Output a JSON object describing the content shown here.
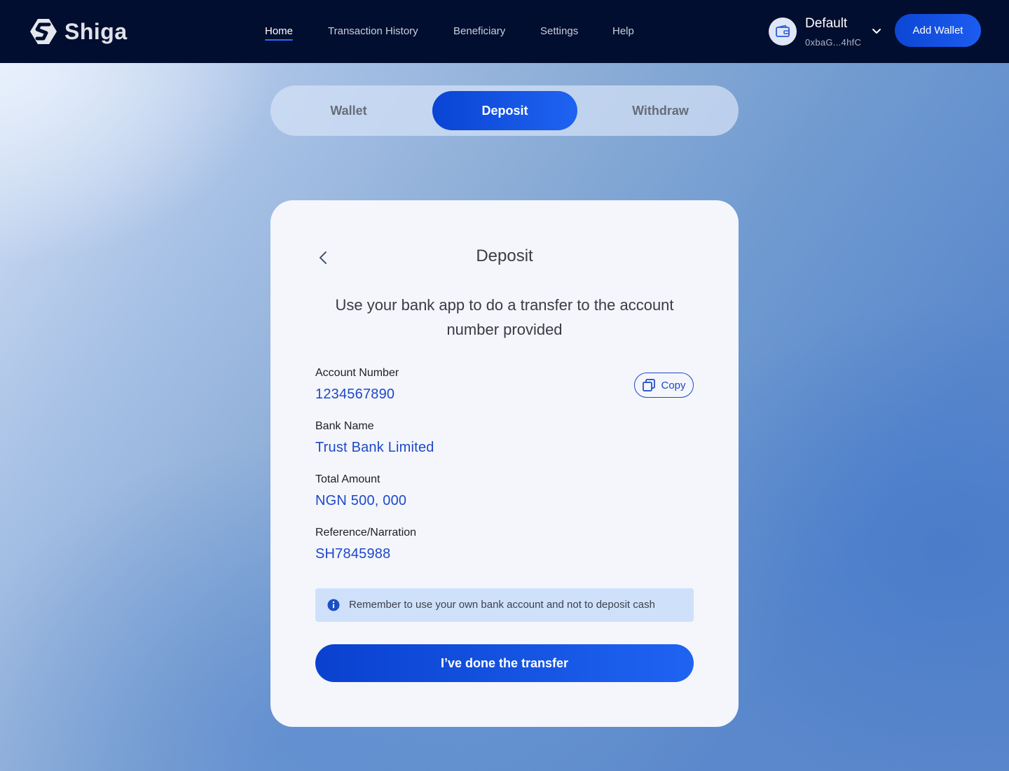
{
  "app": {
    "brand": "Shiga"
  },
  "nav": {
    "items": [
      {
        "label": "Home",
        "active": true
      },
      {
        "label": "Transaction History",
        "active": false
      },
      {
        "label": "Beneficiary",
        "active": false
      },
      {
        "label": "Settings",
        "active": false
      },
      {
        "label": "Help",
        "active": false
      }
    ]
  },
  "wallet": {
    "name": "Default",
    "address": "0xbaG...4hfC",
    "icon": "wallet-icon",
    "add_label": "Add Wallet"
  },
  "tabs": [
    {
      "label": "Wallet",
      "active": false
    },
    {
      "label": "Deposit",
      "active": true
    },
    {
      "label": "Withdraw",
      "active": false
    }
  ],
  "card": {
    "title": "Deposit",
    "instruction": "Use your bank app to do a transfer to the account number provided",
    "copy_label": "Copy",
    "fields": [
      {
        "label": "Account Number",
        "value": "1234567890"
      },
      {
        "label": "Bank Name",
        "value": "Trust Bank Limited"
      },
      {
        "label": "Total Amount",
        "value": "NGN 500, 000"
      },
      {
        "label": "Reference/Narration",
        "value": "SH7845988"
      }
    ],
    "notice": "Remember to use your own bank account and not to deposit cash",
    "done_label": "I’ve done the transfer"
  },
  "colors": {
    "header_bg": "#020e2f",
    "accent": "#1a56e8",
    "value_text": "#1e48c9",
    "notice_bg": "#cfe1fa"
  }
}
